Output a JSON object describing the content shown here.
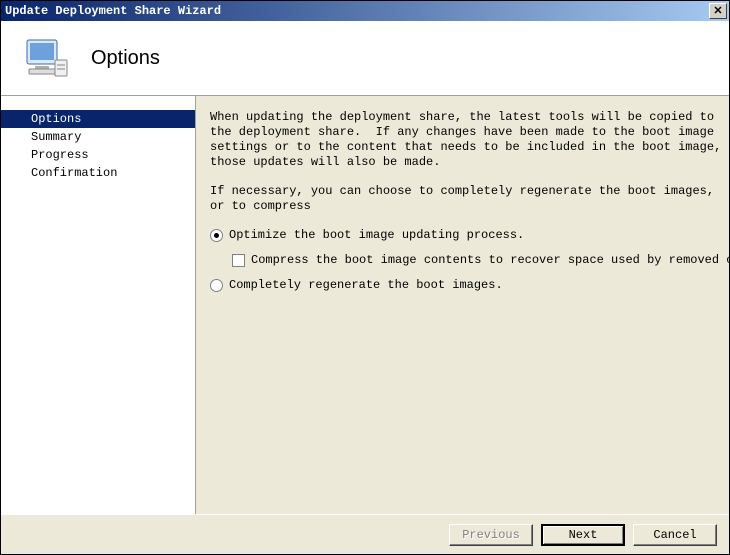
{
  "window": {
    "title": "Update Deployment Share Wizard"
  },
  "header": {
    "title": "Options"
  },
  "sidebar": {
    "steps": [
      {
        "label": "Options",
        "active": true
      },
      {
        "label": "Summary",
        "active": false
      },
      {
        "label": "Progress",
        "active": false
      },
      {
        "label": "Confirmation",
        "active": false
      }
    ]
  },
  "content": {
    "para1": "When updating the deployment share, the latest tools will be copied to the deployment share.  If any changes have been made to the boot image settings or to the content that needs to be included in the boot image, those updates will also be made.",
    "para2": "If necessary, you can choose to completely regenerate the boot images, or to compress",
    "option_optimize": {
      "label": "Optimize the boot image updating process.",
      "checked": true
    },
    "option_compress": {
      "label": "Compress the boot image contents to recover space used by removed or modified co",
      "checked": false
    },
    "option_regenerate": {
      "label": "Completely regenerate the boot images.",
      "checked": false
    }
  },
  "footer": {
    "previous": "Previous",
    "next": "Next",
    "cancel": "Cancel"
  }
}
